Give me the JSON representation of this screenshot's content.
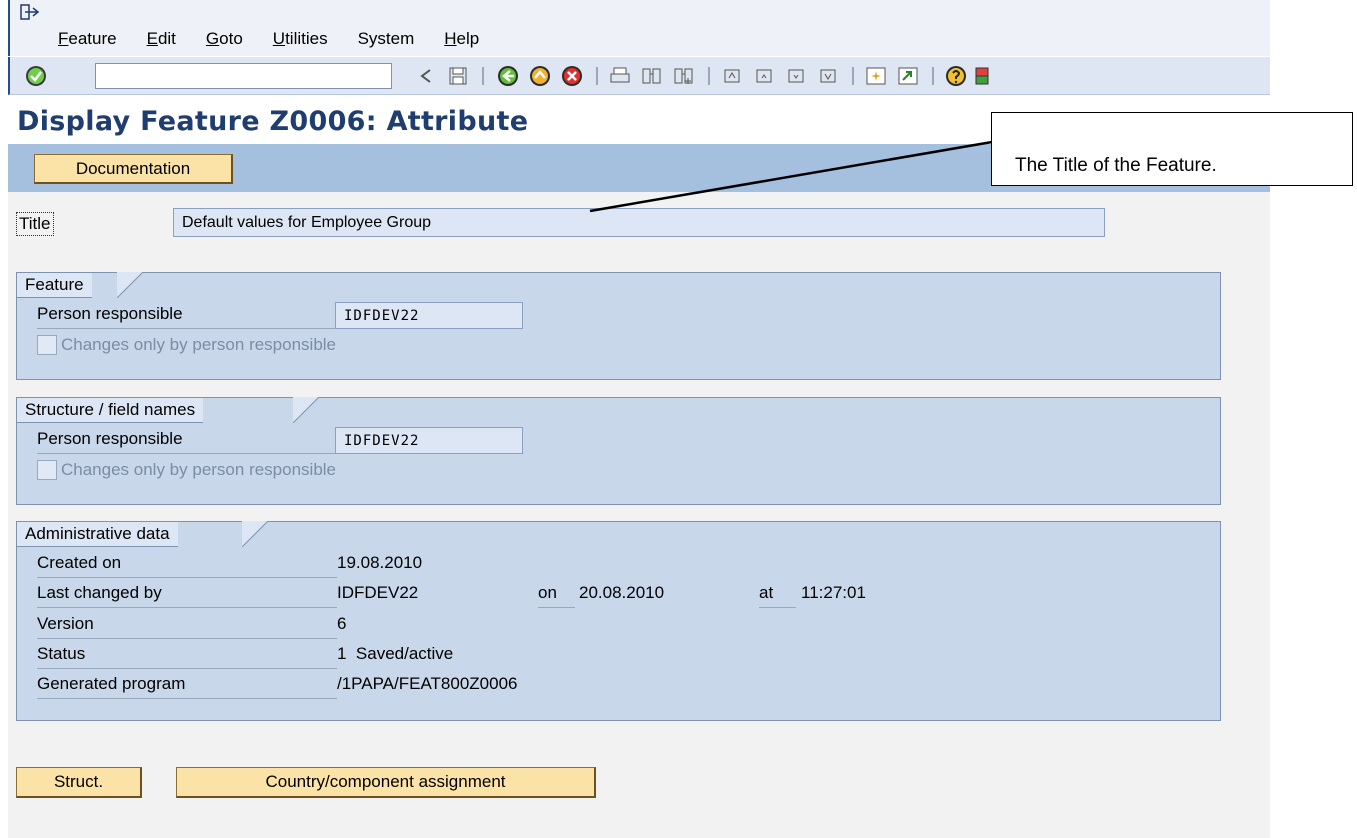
{
  "menubar": {
    "items": [
      {
        "mnemonic": "F",
        "rest": "eature"
      },
      {
        "mnemonic": "E",
        "rest": "dit"
      },
      {
        "mnemonic": "G",
        "rest": "oto"
      },
      {
        "mnemonic": "U",
        "rest": "tilities"
      },
      {
        "mnemonic": "",
        "rest": "System"
      },
      {
        "mnemonic": "H",
        "rest": "elp"
      }
    ]
  },
  "toolbar": {
    "command_value": ""
  },
  "title": "Display Feature Z0006: Attribute",
  "app_toolbar": {
    "documentation_label": "Documentation"
  },
  "title_field": {
    "label": "Title",
    "value": "Default values for Employee Group"
  },
  "feature_group": {
    "heading": "Feature",
    "person_label": "Person responsible",
    "person_value": "IDFDEV22",
    "checkbox_label": "Changes only by person responsible"
  },
  "structure_group": {
    "heading": "Structure / field names",
    "person_label": "Person responsible",
    "person_value": "IDFDEV22",
    "checkbox_label": "Changes only by person responsible"
  },
  "admin_group": {
    "heading": "Administrative data",
    "created_on_label": "Created on",
    "created_on_value": "19.08.2010",
    "last_changed_label": "Last changed by",
    "last_changed_value": "IDFDEV22",
    "on_label": "on",
    "on_value": "20.08.2010",
    "at_label": "at",
    "at_value": "11:27:01",
    "version_label": "Version",
    "version_value": "6",
    "status_label": "Status",
    "status_value": "1  Saved/active",
    "program_label": "Generated program",
    "program_value": "/1PAPA/FEAT800Z0006"
  },
  "bottom_buttons": {
    "struct_label": "Struct.",
    "country_label": "Country/component assignment"
  },
  "callout": {
    "text": "The Title of the Feature."
  }
}
